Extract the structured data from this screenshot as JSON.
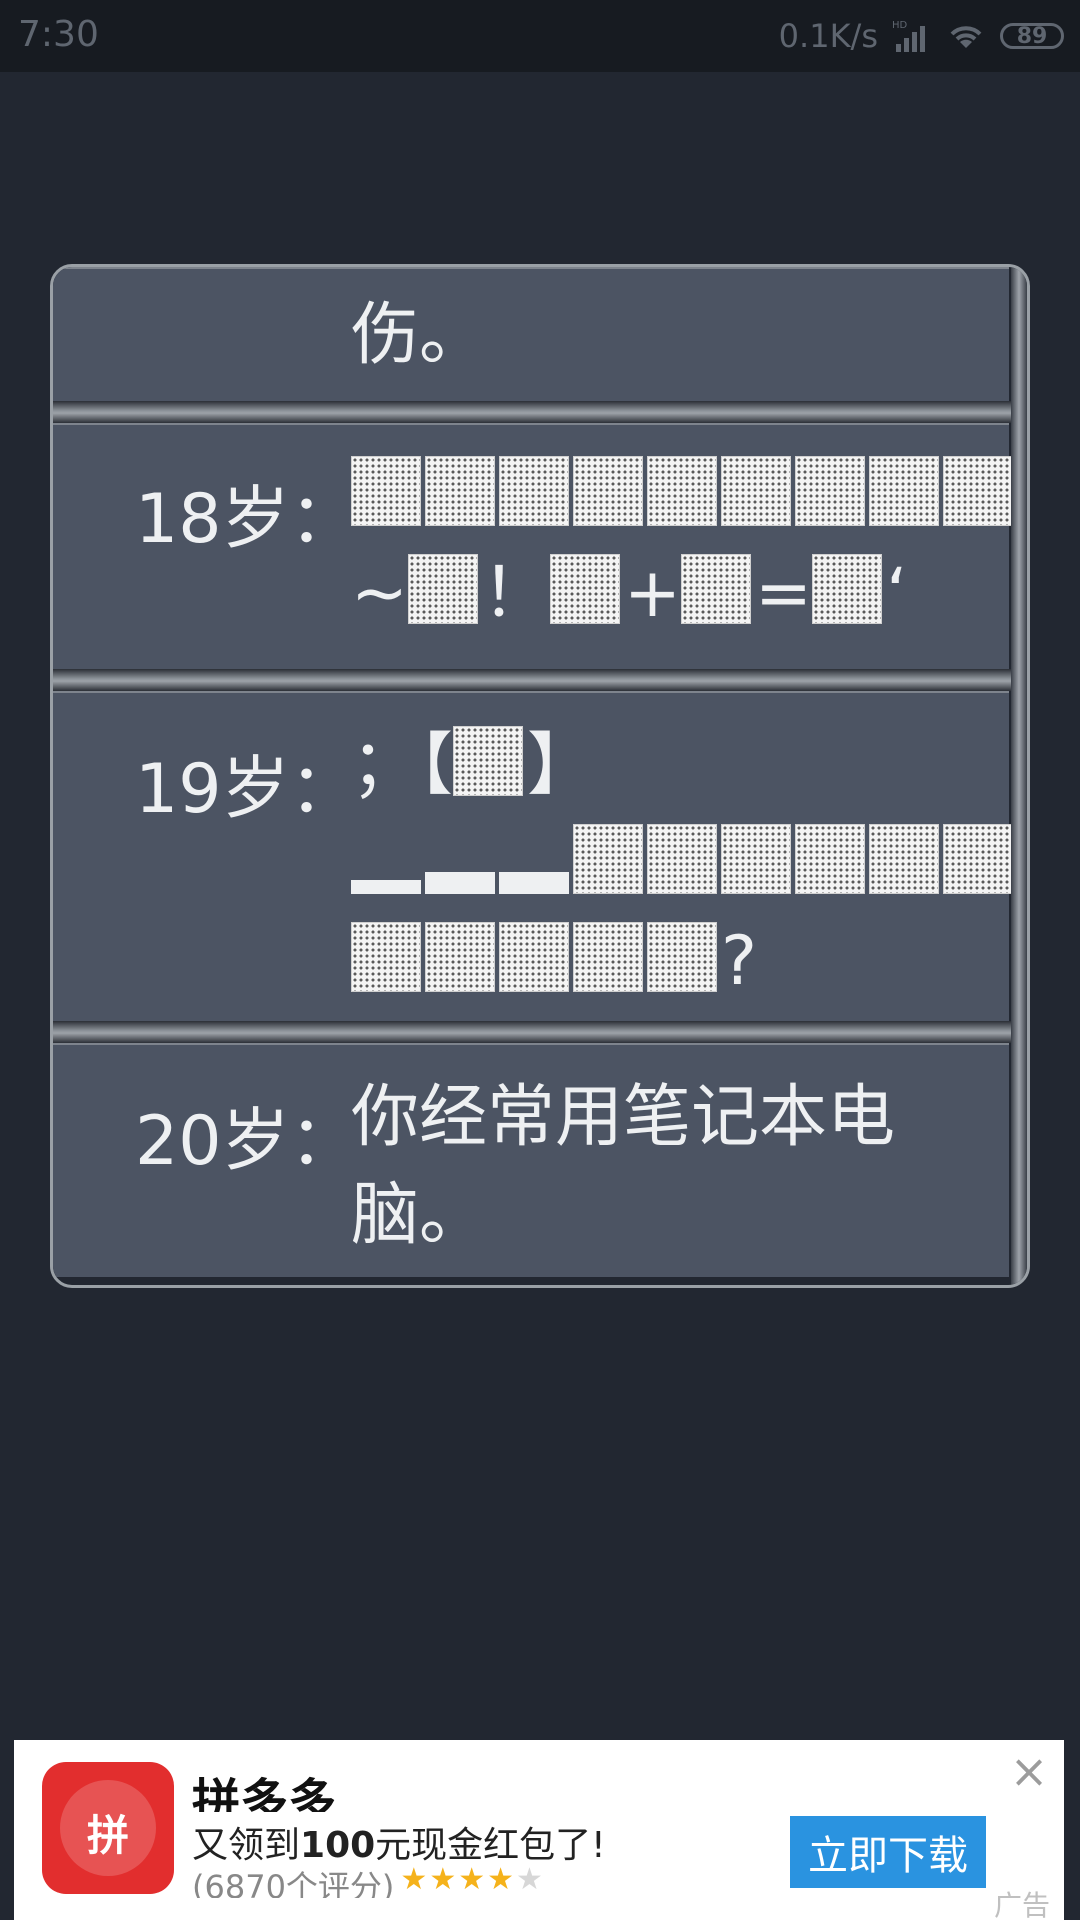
{
  "status_bar": {
    "time": "7:30",
    "net_speed": "0.1K/s",
    "network": "HD",
    "battery": "89"
  },
  "rows": [
    {
      "age": "",
      "lines": [
        "伤。"
      ]
    },
    {
      "age": "18岁：",
      "lines": [
        "▒▒▒▒▒▒▒▒▒",
        "~▒！▒+▒=▒‘"
      ]
    },
    {
      "age": "19岁：",
      "lines": [
        "；【▒】",
        "___▒▒▒▒▒▒",
        "▒▒▒▒▒?"
      ]
    },
    {
      "age": "20岁：",
      "lines": [
        "你经常用笔记本电",
        "脑。"
      ]
    }
  ],
  "ad": {
    "app_name": "拼多多",
    "icon_glyph": "拼",
    "desc_prefix": "又领到",
    "desc_amount": "100",
    "desc_suffix": "元现金红包了!",
    "rating_text": "(6870个评分)",
    "stars": 4,
    "cta": "立即下载",
    "tag": "广告",
    "brand_color": "#e22e2e",
    "cta_color": "#2a93e0"
  }
}
